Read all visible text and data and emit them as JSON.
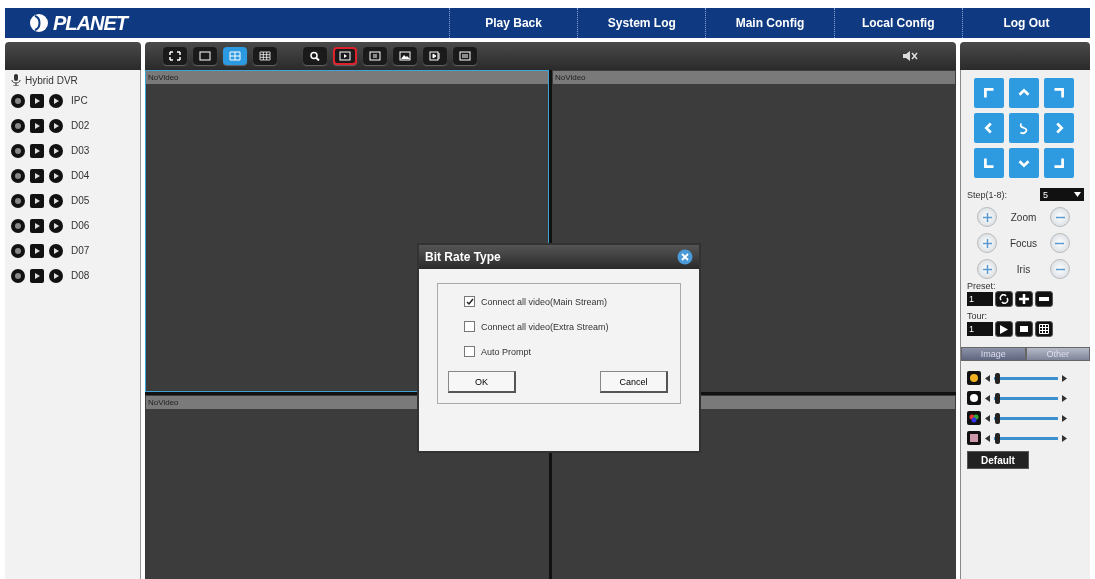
{
  "header": {
    "logo": "PLANET",
    "nav": [
      {
        "label": "Play Back"
      },
      {
        "label": "System Log"
      },
      {
        "label": "Main Config"
      },
      {
        "label": "Local Config"
      },
      {
        "label": "Log Out"
      }
    ]
  },
  "device_tree": {
    "root": "Hybrid DVR",
    "channels": [
      {
        "name": "IPC"
      },
      {
        "name": "D02"
      },
      {
        "name": "D03"
      },
      {
        "name": "D04"
      },
      {
        "name": "D05"
      },
      {
        "name": "D06"
      },
      {
        "name": "D07"
      },
      {
        "name": "D08"
      }
    ]
  },
  "toolbar": {
    "layout_buttons": [
      {
        "selected": false
      },
      {
        "selected": false
      },
      {
        "selected": true
      },
      {
        "selected": false
      }
    ],
    "tool_buttons": [
      {
        "highlighted": false
      },
      {
        "highlighted": true
      },
      {
        "highlighted": false
      },
      {
        "highlighted": false
      },
      {
        "highlighted": false
      },
      {
        "highlighted": false
      }
    ],
    "muted": true
  },
  "video_cells": [
    {
      "label": "NoVideo",
      "selected": true
    },
    {
      "label": "NoVideo",
      "selected": false
    },
    {
      "label": "NoVideo",
      "selected": false
    },
    {
      "selected": false
    }
  ],
  "dialog": {
    "title": "Bit Rate Type",
    "options": [
      {
        "label": "Connect all video(Main Stream)",
        "checked": true
      },
      {
        "label": "Connect all video(Extra Stream)",
        "checked": false
      },
      {
        "label": "Auto Prompt",
        "checked": false
      }
    ],
    "buttons": [
      "OK",
      "Cancel"
    ]
  },
  "ptz": {
    "step_label": "Step(1-8):",
    "step_value": "5",
    "adjust": [
      {
        "label": "Zoom"
      },
      {
        "label": "Focus"
      },
      {
        "label": "Iris"
      }
    ],
    "preset_label": "Preset:",
    "preset_value": "1",
    "tour_label": "Tour:",
    "tour_value": "1"
  },
  "image_tabs": [
    {
      "label": "Image",
      "selected": true
    },
    {
      "label": "Other",
      "selected": false
    }
  ],
  "image_sliders": [
    {
      "level": 0.05
    },
    {
      "level": 0.05
    },
    {
      "level": 0.05
    },
    {
      "level": 0.05
    }
  ],
  "default_button": "Default"
}
